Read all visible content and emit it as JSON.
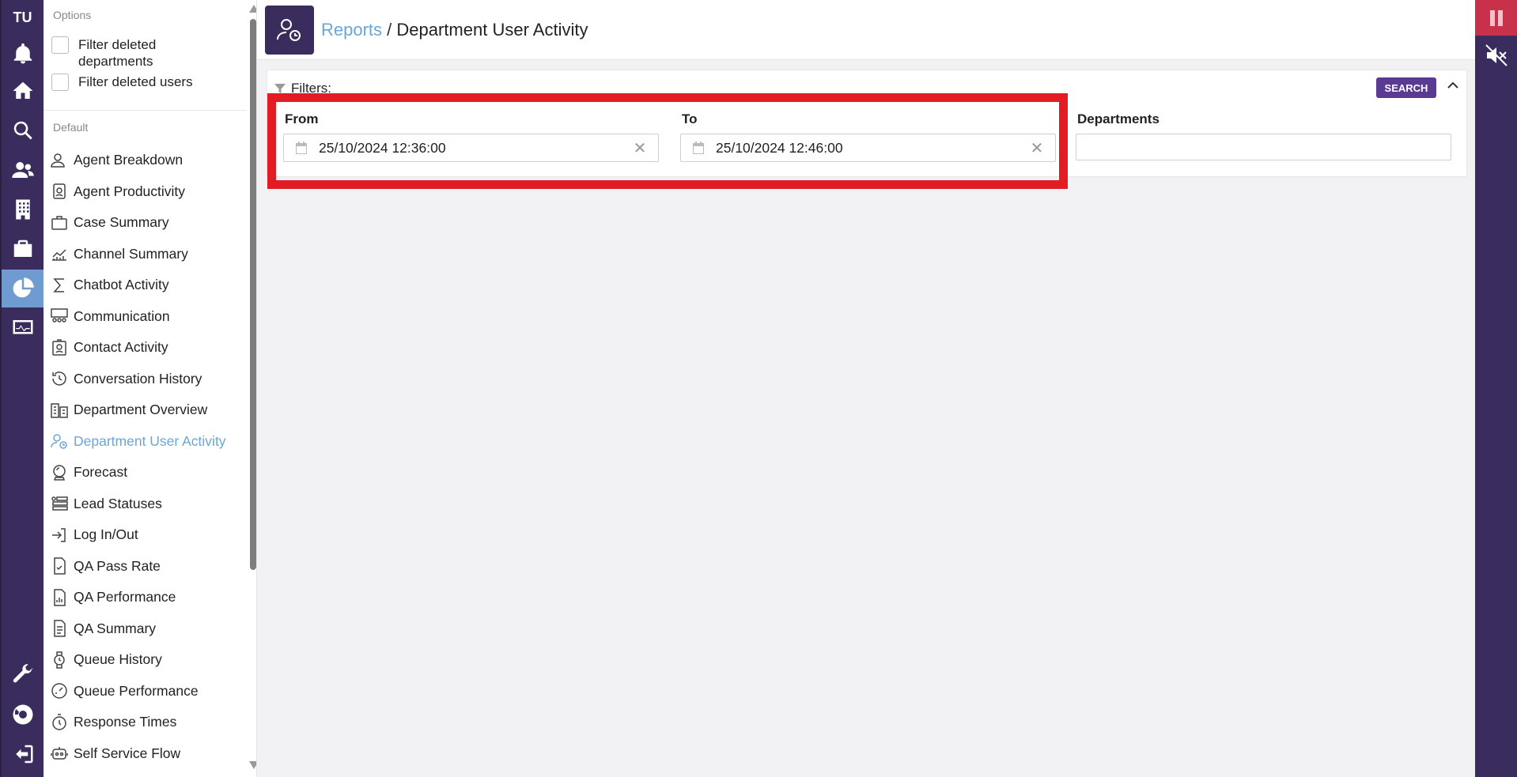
{
  "rail": {
    "avatar": "TU",
    "icons": [
      "bell-icon",
      "home-icon",
      "search-icon",
      "users-icon",
      "building-icon",
      "briefcase-icon",
      "pie-chart-icon",
      "monitor-icon",
      "wrench-icon",
      "lifebuoy-icon",
      "logout-icon"
    ],
    "accent": "#6f9bd1",
    "bg": "#3b2c5e"
  },
  "sidebar": {
    "options_heading": "Options",
    "options": [
      {
        "label": "Filter deleted departments",
        "checked": false
      },
      {
        "label": "Filter deleted users",
        "checked": false
      }
    ],
    "default_heading": "Default",
    "items": [
      {
        "label": "Agent Breakdown",
        "icon": "user-icon"
      },
      {
        "label": "Agent Productivity",
        "icon": "badge-icon"
      },
      {
        "label": "Case Summary",
        "icon": "briefcase-icon"
      },
      {
        "label": "Channel Summary",
        "icon": "chart-area-icon"
      },
      {
        "label": "Chatbot Activity",
        "icon": "sigma-icon"
      },
      {
        "label": "Communication",
        "icon": "people-board-icon"
      },
      {
        "label": "Contact Activity",
        "icon": "contact-card-icon"
      },
      {
        "label": "Conversation History",
        "icon": "history-icon"
      },
      {
        "label": "Department Overview",
        "icon": "buildings-icon"
      },
      {
        "label": "Department User Activity",
        "icon": "user-clock-icon",
        "selected": true
      },
      {
        "label": "Forecast",
        "icon": "crystal-ball-icon"
      },
      {
        "label": "Lead Statuses",
        "icon": "list-status-icon"
      },
      {
        "label": "Log In/Out",
        "icon": "login-icon"
      },
      {
        "label": "QA Pass Rate",
        "icon": "doc-check-icon"
      },
      {
        "label": "QA Performance",
        "icon": "doc-chart-icon"
      },
      {
        "label": "QA Summary",
        "icon": "doc-list-icon"
      },
      {
        "label": "Queue History",
        "icon": "watch-icon"
      },
      {
        "label": "Queue Performance",
        "icon": "gauge-icon"
      },
      {
        "label": "Response Times",
        "icon": "stopwatch-icon"
      },
      {
        "label": "Self Service Flow",
        "icon": "robot-icon"
      }
    ]
  },
  "header": {
    "breadcrumb_link": "Reports",
    "breadcrumb_sep": " / ",
    "breadcrumb_current": "Department User Activity"
  },
  "filters": {
    "label": "Filters:",
    "search_label": "SEARCH",
    "from_label": "From",
    "from_value": "25/10/2024 12:36:00",
    "to_label": "To",
    "to_value": "25/10/2024 12:46:00",
    "departments_label": "Departments",
    "departments_value": ""
  },
  "colors": {
    "highlight": "#e31c23",
    "button": "#5b3a94",
    "link": "#6aa6d8"
  }
}
